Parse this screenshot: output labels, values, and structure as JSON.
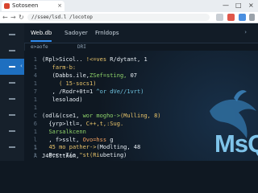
{
  "browser": {
    "tab_title": "Sotoseen",
    "tab_close": "×",
    "address": "//ssee/lsd.l /locotop",
    "window_controls": {
      "minimize": "—",
      "maximize": "□",
      "close": "×"
    },
    "nav_icons": [
      "back-arrow-icon",
      "forward-arrow-icon",
      "reload-icon"
    ]
  },
  "app": {
    "nav_tabs": [
      {
        "label": "Web.db",
        "active": true
      },
      {
        "label": "Sadoyer",
        "active": false
      },
      {
        "label": "Frnldops",
        "active": false
      }
    ],
    "subheader": {
      "left": "e>aofe",
      "right": "DRI"
    },
    "sidebar_active_index": 2,
    "sidebar_chevron": "‹",
    "nav_chevron": "›",
    "code_lines": [
      {
        "n": "1",
        "t1": "(Rpl>Sicol.. ",
        "t2": "!<=ves",
        "t3": " R/dytant, 1"
      },
      {
        "n": "1",
        "t1": "   farm-b:",
        "t2": "",
        "t3": ""
      },
      {
        "n": "4",
        "t1": "   (Dabbs.ile,",
        "t2": "ZSef=sting,",
        "t3": " 07"
      },
      {
        "n": "1",
        "t1": "     ( 15-socs1)",
        "t2": "",
        "t3": ""
      },
      {
        "n": "7",
        "t1": "   , /Rodr+0t=1",
        "t2": "",
        "t3": " ^or dVe//1vrt)"
      },
      {
        "n": "1",
        "t1": "   lesolaod)",
        "t2": "",
        "t3": ""
      },
      {
        "n": "1",
        "t1": "",
        "t2": "",
        "t3": ""
      },
      {
        "n": "C",
        "t1": "(odl&(cse1, ",
        "t2": "wor mogho->",
        "t3": "(Mulling, 8)"
      },
      {
        "n": "6",
        "t1": "  {yrp>ltl=, ",
        "t2": "C++,t,:Sug.",
        "t3": ""
      },
      {
        "n": "1",
        "t1": "  ",
        "t2": "Sarsalkcenn",
        "t3": ""
      },
      {
        "n": "l",
        "t1": "  , f>sslt, ",
        "t2": "Ovo=hss ",
        "t3": "g"
      },
      {
        "n": "1",
        "t1": "",
        "t2": "",
        "t3": ""
      },
      {
        "n": "A",
        "t1": "J49.Sttnon,",
        "t2": "",
        "t3": ""
      },
      {
        "n": "1",
        "t1": "  ",
        "t2": "45 mo pather->",
        "t3": "(Modlting, 48"
      },
      {
        "n": "t",
        "t1": "  Per--T(o ",
        "t2": "\"st(Ri",
        "t3": "ubeting)"
      }
    ],
    "logo": {
      "text": "MsQ",
      "color": "#7fc4ea"
    }
  }
}
